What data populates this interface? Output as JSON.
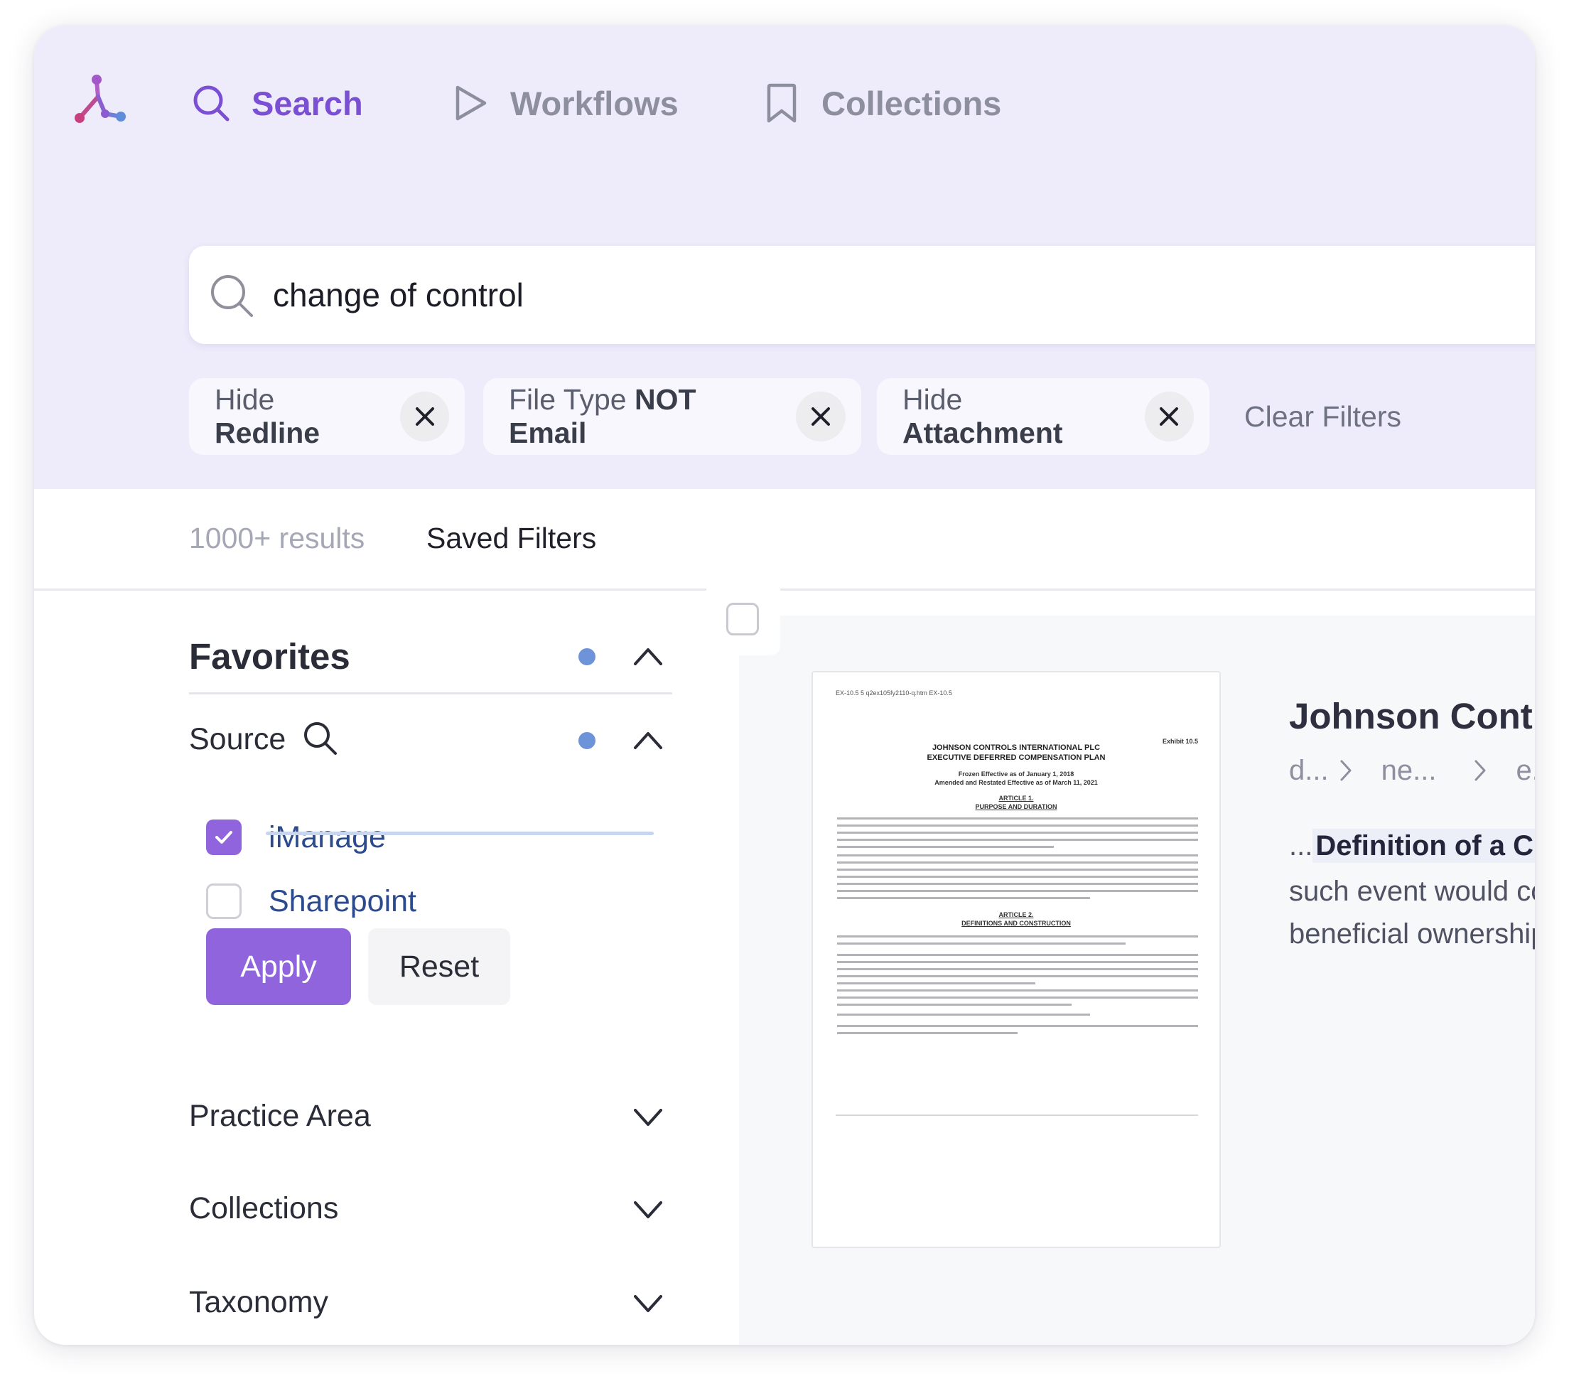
{
  "nav": {
    "items": [
      {
        "label": "Search",
        "icon": "search-icon",
        "active": true
      },
      {
        "label": "Workflows",
        "icon": "play-icon",
        "active": false
      },
      {
        "label": "Collections",
        "icon": "bookmark-icon",
        "active": false
      }
    ]
  },
  "search": {
    "query": "change of control"
  },
  "filters": {
    "chips": [
      {
        "prefix": "Hide",
        "strong": "Redline"
      },
      {
        "prefix": "File Type",
        "strong": "NOT Email"
      },
      {
        "prefix": "Hide",
        "strong": "Attachment"
      }
    ],
    "clear_label": "Clear Filters"
  },
  "results": {
    "count": "1000+ results",
    "saved_filters": "Saved Filters"
  },
  "sidebar": {
    "favorites_title": "Favorites",
    "source": {
      "title": "Source",
      "options": [
        {
          "label": "iManage",
          "checked": true
        },
        {
          "label": "Sharepoint",
          "checked": false
        }
      ],
      "apply_label": "Apply",
      "reset_label": "Reset"
    },
    "sections": [
      {
        "title": "Practice Area"
      },
      {
        "title": "Collections"
      },
      {
        "title": "Taxonomy"
      }
    ]
  },
  "result_card": {
    "title": "Johnson Controls",
    "breadcrumbs": [
      "d...",
      "ne...",
      "e."
    ],
    "snippet_prefix": "...",
    "snippet_highlight": "Definition of a Chang",
    "snippet_line2": "such event would cons",
    "snippet_line3": "beneficial ownership (w",
    "thumbnail": {
      "header": "EX-10.5 5 q2ex105fy2110-q.htm EX-10.5",
      "exhibit": "Exhibit 10.5",
      "title_line1": "JOHNSON CONTROLS INTERNATIONAL PLC",
      "title_line2": "EXECUTIVE DEFERRED COMPENSATION PLAN",
      "sub_line1": "Frozen Effective as of January 1, 2018",
      "sub_line2": "Amended and Restated Effective as of March 11, 2021",
      "article1": "ARTICLE 1.",
      "article1_name": "PURPOSE AND DURATION",
      "article2": "ARTICLE 2.",
      "article2_name": "DEFINITIONS AND CONSTRUCTION"
    }
  },
  "colors": {
    "accent": "#8f64dc",
    "nav_active": "#7a4fd4",
    "hero_bg": "#eeecfb",
    "dot": "#6d93d9"
  }
}
